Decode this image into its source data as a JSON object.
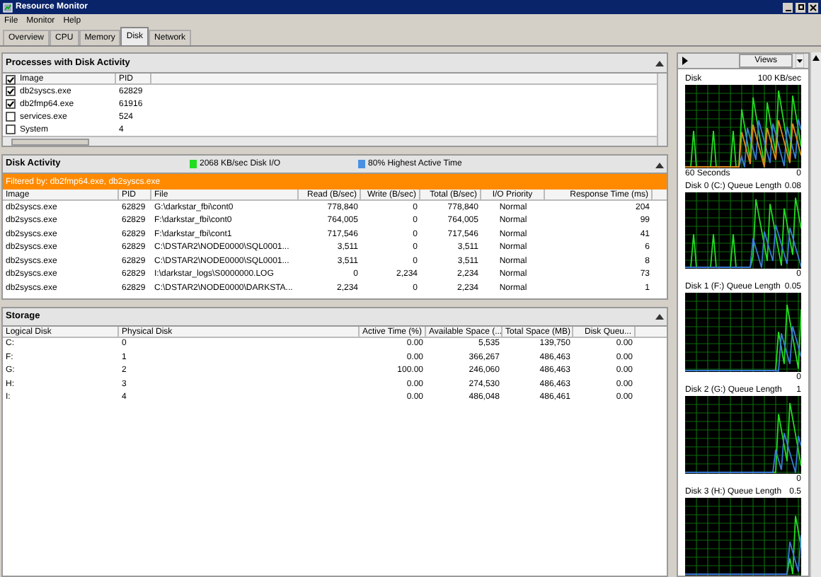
{
  "window": {
    "title": "Resource Monitor"
  },
  "menu": [
    "File",
    "Monitor",
    "Help"
  ],
  "tabs": [
    {
      "label": "Overview",
      "selected": false
    },
    {
      "label": "CPU",
      "selected": false
    },
    {
      "label": "Memory",
      "selected": false
    },
    {
      "label": "Disk",
      "selected": true
    },
    {
      "label": "Network",
      "selected": false
    }
  ],
  "processes": {
    "title": "Processes with Disk Activity",
    "all_checked": true,
    "columns": [
      "Image",
      "PID"
    ],
    "rows": [
      {
        "image": "db2syscs.exe",
        "pid": "62829",
        "checked": true
      },
      {
        "image": "db2fmp64.exe",
        "pid": "61916",
        "checked": true
      },
      {
        "image": "services.exe",
        "pid": "524",
        "checked": false
      },
      {
        "image": "System",
        "pid": "4",
        "checked": false
      }
    ]
  },
  "disk_activity": {
    "title": "Disk Activity",
    "legend": [
      {
        "label": "2068 KB/sec Disk I/O",
        "color": "#22dd22"
      },
      {
        "label": "80% Highest Active Time",
        "color": "#4a90e2"
      }
    ],
    "filter": "Filtered by: db2fmp64.exe, db2syscs.exe",
    "columns": [
      "Image",
      "PID",
      "File",
      "Read (B/sec)",
      "Write (B/sec)",
      "Total (B/sec)",
      "I/O Priority",
      "Response Time (ms)"
    ],
    "rows": [
      [
        "db2syscs.exe",
        "62829",
        "G:\\darkstar_fbi\\cont0",
        "778,840",
        "0",
        "778,840",
        "Normal",
        "204"
      ],
      [
        "db2syscs.exe",
        "62829",
        "F:\\darkstar_fbi\\cont0",
        "764,005",
        "0",
        "764,005",
        "Normal",
        "99"
      ],
      [
        "db2syscs.exe",
        "62829",
        "F:\\darkstar_fbi\\cont1",
        "717,546",
        "0",
        "717,546",
        "Normal",
        "41"
      ],
      [
        "db2syscs.exe",
        "62829",
        "C:\\DSTAR2\\NODE0000\\SQL0001...",
        "3,511",
        "0",
        "3,511",
        "Normal",
        "6"
      ],
      [
        "db2syscs.exe",
        "62829",
        "C:\\DSTAR2\\NODE0000\\SQL0001...",
        "3,511",
        "0",
        "3,511",
        "Normal",
        "8"
      ],
      [
        "db2syscs.exe",
        "62829",
        "I:\\darkstar_logs\\S0000000.LOG",
        "0",
        "2,234",
        "2,234",
        "Normal",
        "73"
      ],
      [
        "db2syscs.exe",
        "62829",
        "C:\\DSTAR2\\NODE0000\\DARKSTA...",
        "2,234",
        "0",
        "2,234",
        "Normal",
        "1"
      ]
    ]
  },
  "storage": {
    "title": "Storage",
    "columns": [
      "Logical Disk",
      "Physical Disk",
      "Active Time (%)",
      "Available Space (...",
      "Total Space (MB)",
      "Disk Queu..."
    ],
    "rows": [
      [
        "C:",
        "0",
        "0.00",
        "5,535",
        "139,750",
        "0.00"
      ],
      [
        "F:",
        "1",
        "0.00",
        "366,267",
        "486,463",
        "0.00"
      ],
      [
        "G:",
        "2",
        "100.00",
        "246,060",
        "486,463",
        "0.00"
      ],
      [
        "H:",
        "3",
        "0.00",
        "274,530",
        "486,463",
        "0.00"
      ],
      [
        "I:",
        "4",
        "0.00",
        "486,048",
        "486,461",
        "0.00"
      ]
    ]
  },
  "graphs_panel": {
    "views_button": "Views",
    "graphs": [
      {
        "title": "Disk",
        "scale": "100 KB/sec",
        "footer": "60 Seconds",
        "min": "0"
      },
      {
        "title": "Disk 0 (C:) Queue Length",
        "scale": "0.08",
        "min": "0"
      },
      {
        "title": "Disk 1 (F:) Queue Length",
        "scale": "0.05",
        "min": "0"
      },
      {
        "title": "Disk 2 (G:) Queue Length",
        "scale": "1",
        "min": "0"
      },
      {
        "title": "Disk 3 (H:) Queue Length",
        "scale": "0.5"
      }
    ]
  }
}
